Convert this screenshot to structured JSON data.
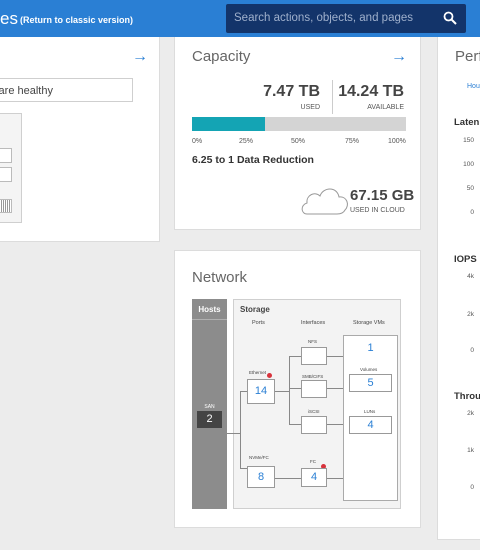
{
  "header": {
    "title": "es",
    "classic_link": "(Return to classic version)",
    "search_placeholder": "Search actions, objects, and pages"
  },
  "health": {
    "status_text": "s are healthy",
    "panel_label": "r"
  },
  "capacity": {
    "title": "Capacity",
    "used_value": "7.47 TB",
    "used_label": "USED",
    "available_value": "14.24 TB",
    "available_label": "AVAILABLE",
    "used_fraction": 0.34,
    "ticks": [
      "0%",
      "25%",
      "50%",
      "75%",
      "100%"
    ],
    "reduction": "6.25 to 1 Data Reduction",
    "cloud_value": "67.15 GB",
    "cloud_label": "USED IN CLOUD"
  },
  "network": {
    "title": "Network",
    "hosts_label": "Hosts",
    "san_label": "SAN",
    "san_count": "2",
    "storage_label": "Storage",
    "col_ports": "Ports",
    "col_interfaces": "Interfaces",
    "col_vms": "Storage VMs",
    "ethernet_label": "Ethernet",
    "ethernet_count": "14",
    "nvme_label": "NVMe/FC",
    "nvme_count": "8",
    "nfs_label": "NFS",
    "smb_label": "SMB/CIFS",
    "iscsi_label": "iSCSI",
    "fc_label": "FC",
    "fc_count": "4",
    "vms_count": "1",
    "volumes_label": "Volumes",
    "volumes_count": "5",
    "luns_label": "LUNs",
    "luns_count": "4"
  },
  "performance": {
    "title": "Perfo",
    "hours_link": "Hou",
    "latency_label": "Laten",
    "latency_ticks": [
      "150",
      "100",
      "50",
      "0"
    ],
    "iops_label": "IOPS",
    "iops_ticks": [
      "4k",
      "2k",
      "0"
    ],
    "throughput_label": "Throu",
    "throughput_ticks": [
      "2k",
      "1k",
      "0"
    ]
  },
  "colors": {
    "header": "#2a7fd4",
    "search": "#13346a",
    "capacity_fill": "#14a4b4",
    "alert": "#d8323c"
  }
}
